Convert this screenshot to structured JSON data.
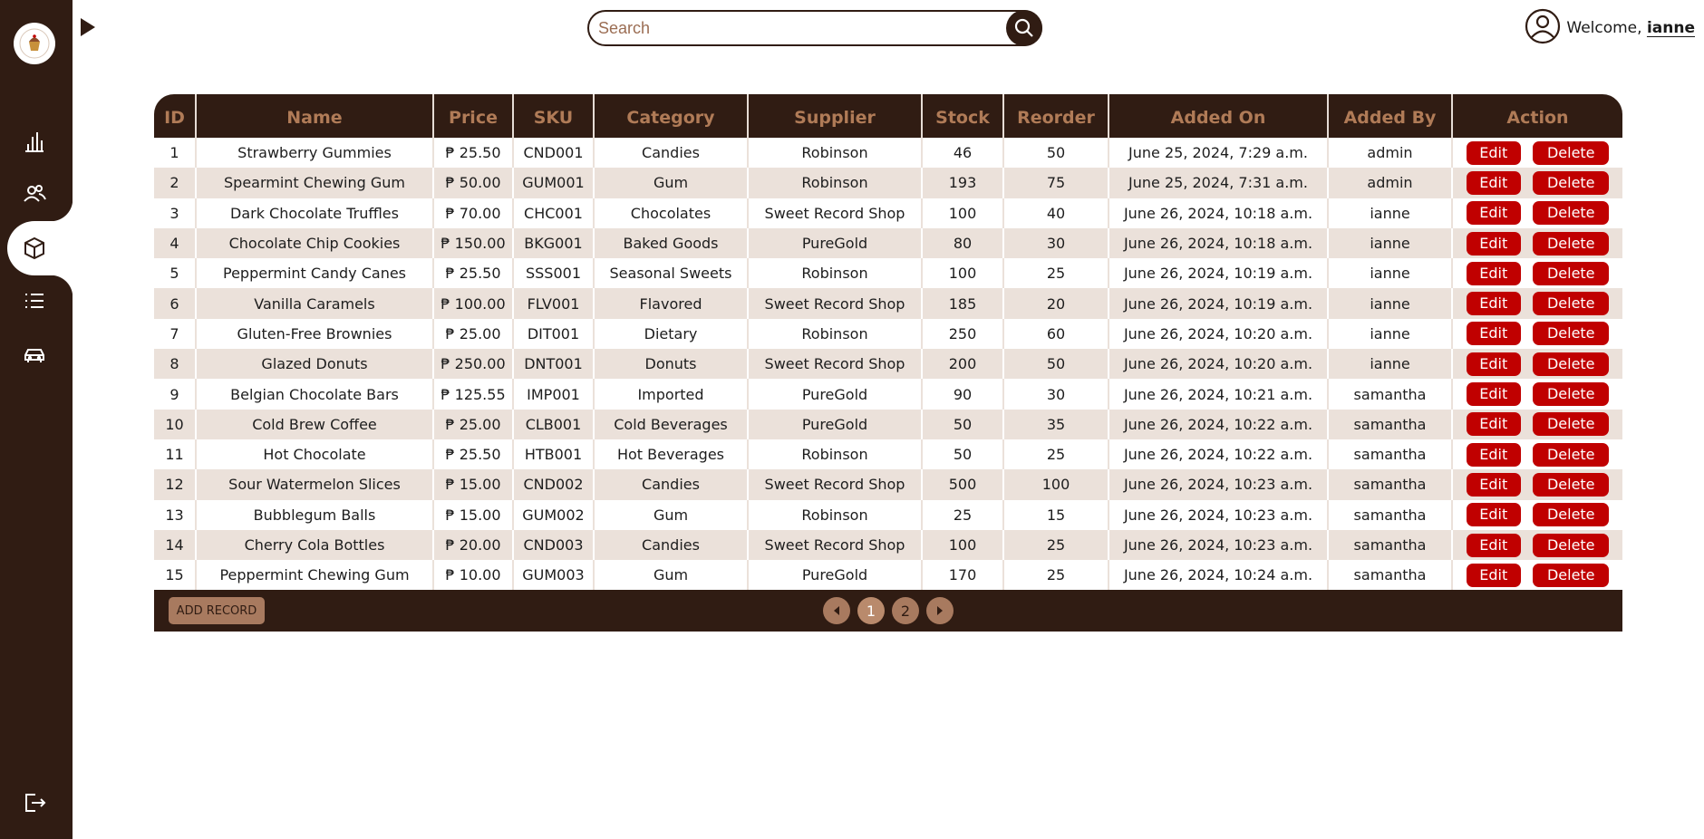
{
  "search": {
    "placeholder": "Search"
  },
  "user": {
    "welcome": "Welcome, ",
    "name": "ianne"
  },
  "sidebar": {
    "items": [
      {
        "name": "dashboard",
        "icon": "bar-chart-icon"
      },
      {
        "name": "users",
        "icon": "users-icon"
      },
      {
        "name": "inventory",
        "icon": "box-icon",
        "active": true
      },
      {
        "name": "list",
        "icon": "list-icon"
      },
      {
        "name": "deliveries",
        "icon": "car-icon"
      }
    ],
    "logout_icon": "logout-icon"
  },
  "table": {
    "headers": [
      "ID",
      "Name",
      "Price",
      "SKU",
      "Category",
      "Supplier",
      "Stock",
      "Reorder",
      "Added On",
      "Added By",
      "Action"
    ],
    "edit_label": "Edit",
    "delete_label": "Delete",
    "rows": [
      [
        "1",
        "Strawberry Gummies",
        "₱ 25.50",
        "CND001",
        "Candies",
        "Robinson",
        "46",
        "50",
        "June 25, 2024, 7:29 a.m.",
        "admin"
      ],
      [
        "2",
        "Spearmint Chewing Gum",
        "₱ 50.00",
        "GUM001",
        "Gum",
        "Robinson",
        "193",
        "75",
        "June 25, 2024, 7:31 a.m.",
        "admin"
      ],
      [
        "3",
        "Dark Chocolate Truffles",
        "₱ 70.00",
        "CHC001",
        "Chocolates",
        "Sweet Record Shop",
        "100",
        "40",
        "June 26, 2024, 10:18 a.m.",
        "ianne"
      ],
      [
        "4",
        "Chocolate Chip Cookies",
        "₱ 150.00",
        "BKG001",
        "Baked Goods",
        "PureGold",
        "80",
        "30",
        "June 26, 2024, 10:18 a.m.",
        "ianne"
      ],
      [
        "5",
        "Peppermint Candy Canes",
        "₱ 25.50",
        "SSS001",
        "Seasonal Sweets",
        "Robinson",
        "100",
        "25",
        "June 26, 2024, 10:19 a.m.",
        "ianne"
      ],
      [
        "6",
        "Vanilla Caramels",
        "₱ 100.00",
        "FLV001",
        "Flavored",
        "Sweet Record Shop",
        "185",
        "20",
        "June 26, 2024, 10:19 a.m.",
        "ianne"
      ],
      [
        "7",
        "Gluten-Free Brownies",
        "₱ 25.00",
        "DIT001",
        "Dietary",
        "Robinson",
        "250",
        "60",
        "June 26, 2024, 10:20 a.m.",
        "ianne"
      ],
      [
        "8",
        "Glazed Donuts",
        "₱ 250.00",
        "DNT001",
        "Donuts",
        "Sweet Record Shop",
        "200",
        "50",
        "June 26, 2024, 10:20 a.m.",
        "ianne"
      ],
      [
        "9",
        "Belgian Chocolate Bars",
        "₱ 125.55",
        "IMP001",
        "Imported",
        "PureGold",
        "90",
        "30",
        "June 26, 2024, 10:21 a.m.",
        "samantha"
      ],
      [
        "10",
        "Cold Brew Coffee",
        "₱ 25.00",
        "CLB001",
        "Cold Beverages",
        "PureGold",
        "50",
        "35",
        "June 26, 2024, 10:22 a.m.",
        "samantha"
      ],
      [
        "11",
        "Hot Chocolate",
        "₱ 25.50",
        "HTB001",
        "Hot Beverages",
        "Robinson",
        "50",
        "25",
        "June 26, 2024, 10:22 a.m.",
        "samantha"
      ],
      [
        "12",
        "Sour Watermelon Slices",
        "₱ 15.00",
        "CND002",
        "Candies",
        "Sweet Record Shop",
        "500",
        "100",
        "June 26, 2024, 10:23 a.m.",
        "samantha"
      ],
      [
        "13",
        "Bubblegum Balls",
        "₱ 15.00",
        "GUM002",
        "Gum",
        "Robinson",
        "25",
        "15",
        "June 26, 2024, 10:23 a.m.",
        "samantha"
      ],
      [
        "14",
        "Cherry Cola Bottles",
        "₱ 20.00",
        "CND003",
        "Candies",
        "Sweet Record Shop",
        "100",
        "25",
        "June 26, 2024, 10:23 a.m.",
        "samantha"
      ],
      [
        "15",
        "Peppermint Chewing Gum",
        "₱ 10.00",
        "GUM003",
        "Gum",
        "PureGold",
        "170",
        "25",
        "June 26, 2024, 10:24 a.m.",
        "samantha"
      ]
    ]
  },
  "footer": {
    "add_label": "ADD RECORD",
    "pages": [
      "1",
      "2"
    ],
    "current_page": "1"
  },
  "colors": {
    "sidebar": "#301c13",
    "header_text": "#b07b57",
    "row_alt": "#ebe1da",
    "danger": "#c00000",
    "accent": "#a87a5f"
  }
}
